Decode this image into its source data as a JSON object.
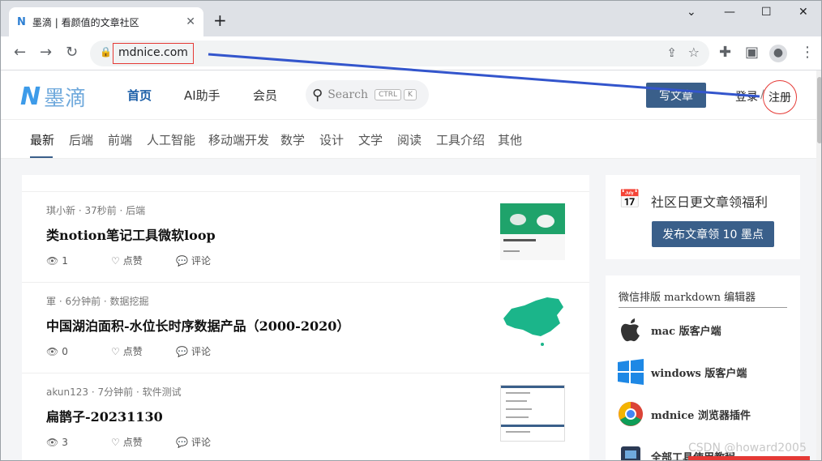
{
  "browser": {
    "tab_title": "墨滴 | 看颜值的文章社区",
    "tab_favicon": "N",
    "url": "mdnice.com"
  },
  "site": {
    "logo_mark": "N",
    "logo_text": "墨滴",
    "nav": [
      "首页",
      "AI助手",
      "会员"
    ],
    "search_placeholder": "Search",
    "search_keys": [
      "CTRL",
      "K"
    ],
    "write_button": "写文章",
    "login": "登录",
    "separator": "/",
    "register": "注册",
    "categories": [
      "最新",
      "后端",
      "前端",
      "人工智能",
      "移动端开发",
      "数学",
      "设计",
      "文学",
      "阅读",
      "工具介绍",
      "其他"
    ]
  },
  "feed": [
    {
      "meta": "琪小新 · 37秒前 · 后端",
      "title": "类notion笔记工具微软loop",
      "views": "1",
      "like": "点赞",
      "comment": "评论"
    },
    {
      "meta": "軍 · 6分钟前 · 数据挖掘",
      "title": "中国湖泊面积-水位长时序数据产品（2000-2020）",
      "views": "0",
      "like": "点赞",
      "comment": "评论"
    },
    {
      "meta": "akun123 · 7分钟前 · 软件测试",
      "title": "扁鹊子-20231130",
      "views": "3",
      "like": "点赞",
      "comment": "评论"
    }
  ],
  "sidebar": {
    "welfare_title": "社区日更文章领福利",
    "welfare_button": "发布文章领 10 墨点",
    "editor_title": "微信排版 markdown 编辑器",
    "downloads": [
      "mac 版客户端",
      "windows 版客户端",
      "mdnice 浏览器插件",
      "全部工具使用教程"
    ]
  },
  "watermark": "CSDN @howard2005",
  "colors": {
    "accent": "#3a5f8a",
    "annotation_red": "#e53935",
    "annotation_blue": "#3355cc"
  }
}
